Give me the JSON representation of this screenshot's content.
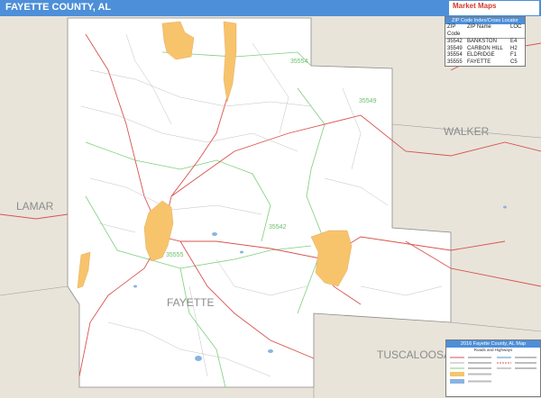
{
  "header": {
    "title": "FAYETTE COUNTY, AL",
    "logo_text": "Market Maps",
    "logo_sub": ""
  },
  "map": {
    "neighbor_labels": [
      "LAMAR",
      "WALKER",
      "TUSCALOOSA"
    ],
    "place_labels": [
      "FAYETTE"
    ],
    "zip_labels": [
      "35554",
      "35549",
      "35542",
      "35555"
    ],
    "colors": {
      "county": "#ffffff",
      "outside": "#e8e4da",
      "city": "#f7c46c",
      "roads": "#d9534f",
      "zip_lines": "#7ccf7c",
      "water": "#8ab4e0"
    }
  },
  "zip_table": {
    "title": "ZIP Code Index/Cross Locator",
    "headers": [
      "ZIP Code",
      "ZIP Name",
      "LOC"
    ],
    "rows": [
      [
        "35542",
        "BANKSTON",
        "E4"
      ],
      [
        "35549",
        "CARBON HILL",
        "H2"
      ],
      [
        "35554",
        "ELDRIDGE",
        "F1"
      ],
      [
        "35555",
        "FAYETTE",
        "C5"
      ]
    ]
  },
  "legend": {
    "title": "2016 Fayette County, AL Map",
    "subtitle": "Roads and Highways"
  }
}
